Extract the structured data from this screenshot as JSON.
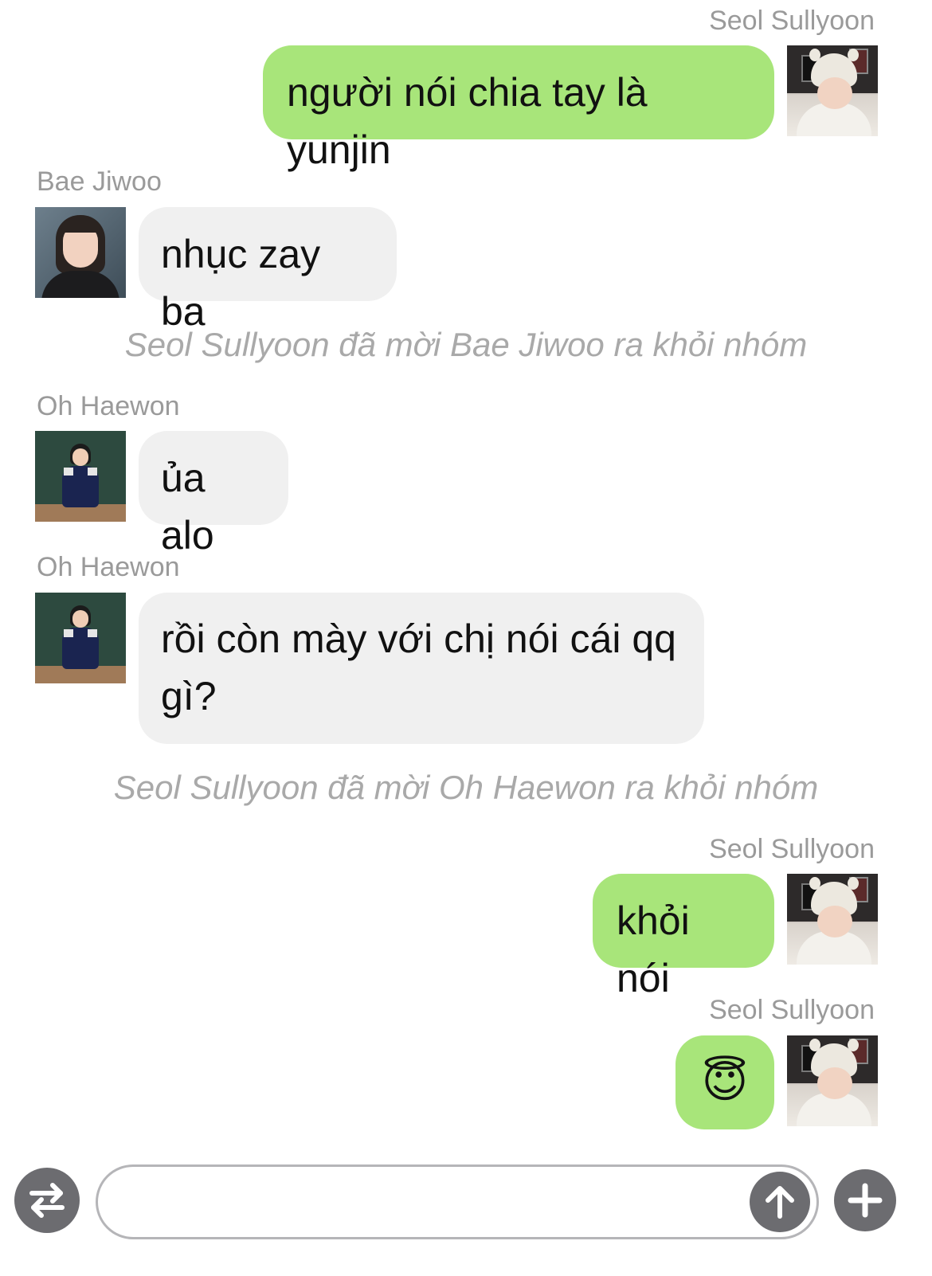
{
  "messages": [
    {
      "sender": "Seol Sullyoon",
      "direction": "out",
      "text": "người nói chia tay là yunjin"
    },
    {
      "sender": "Bae Jiwoo",
      "direction": "in",
      "text": "nhục zay ba"
    },
    {
      "system": "Seol Sullyoon đã mời Bae Jiwoo ra khỏi nhóm"
    },
    {
      "sender": "Oh Haewon",
      "direction": "in",
      "text": "ủa alo"
    },
    {
      "sender": "Oh Haewon",
      "direction": "in",
      "text": "rồi còn mày với chị nói cái qq gì?"
    },
    {
      "system": "Seol Sullyoon đã mời Oh Haewon ra khỏi nhóm"
    },
    {
      "sender": "Seol Sullyoon",
      "direction": "out",
      "text": "khỏi nói"
    },
    {
      "sender": "Seol Sullyoon",
      "direction": "out",
      "text": "😇"
    }
  ],
  "composer": {
    "value": "",
    "left_icon": "swap-arrows-icon",
    "send_icon": "arrow-up-icon",
    "add_icon": "plus-icon"
  },
  "colors": {
    "outgoing_bubble": "#a8e57a",
    "incoming_bubble": "#f0f0f0",
    "sender_name": "#9a9a9a",
    "system_text": "#a9a9a9",
    "button": "#6c6c70"
  }
}
